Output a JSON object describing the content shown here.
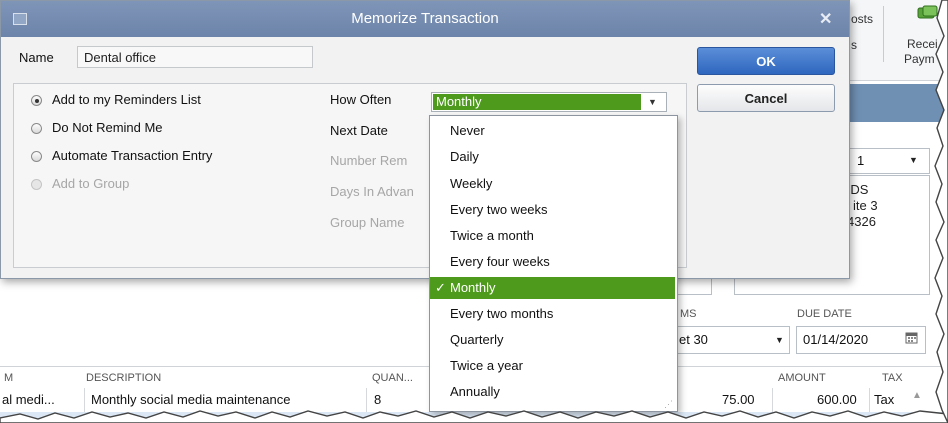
{
  "background": {
    "toolbar": {
      "item1": "osts",
      "item2": "s",
      "item3_line1": "Recei",
      "item3_line2": "Paym"
    },
    "dropdown_value": "1",
    "address": [
      "DDS",
      "ite 3",
      "4326"
    ],
    "terms_header": "MS",
    "terms_value": "et 30",
    "due_date_header": "DUE DATE",
    "due_date_value": "01/14/2020",
    "grid": {
      "headers": {
        "item": "M",
        "description": "DESCRIPTION",
        "quantity": "QUAN...",
        "amount": "AMOUNT",
        "tax": "TAX"
      },
      "row": {
        "item": "al medi...",
        "description": "Monthly social media maintenance",
        "quantity": "8",
        "rate": "75.00",
        "amount": "600.00",
        "tax": "Tax"
      }
    }
  },
  "dialog": {
    "title": "Memorize Transaction",
    "name_label": "Name",
    "name_value": "Dental office",
    "ok_label": "OK",
    "cancel_label": "Cancel",
    "options": [
      {
        "label": "Add to my Reminders List",
        "selected": true,
        "disabled": false
      },
      {
        "label": "Do Not Remind Me",
        "selected": false,
        "disabled": false
      },
      {
        "label": "Automate Transaction Entry",
        "selected": false,
        "disabled": false
      },
      {
        "label": "Add to Group",
        "selected": false,
        "disabled": true
      }
    ],
    "how_often_label": "How Often",
    "how_often_value": "Monthly",
    "next_date_label": "Next Date",
    "number_remaining_label": "Number Rem",
    "days_in_advance_label": "Days In Advan",
    "group_name_label": "Group Name"
  },
  "dropdown": {
    "options": [
      "Never",
      "Daily",
      "Weekly",
      "Every two weeks",
      "Twice a month",
      "Every four weeks",
      "Monthly",
      "Every two months",
      "Quarterly",
      "Twice a year",
      "Annually"
    ],
    "selected": "Monthly",
    "check": "✓"
  },
  "colors": {
    "selection_green": "#4e9a1c",
    "title_blue": "#7389ad",
    "ok_blue": "#3a72c8"
  }
}
